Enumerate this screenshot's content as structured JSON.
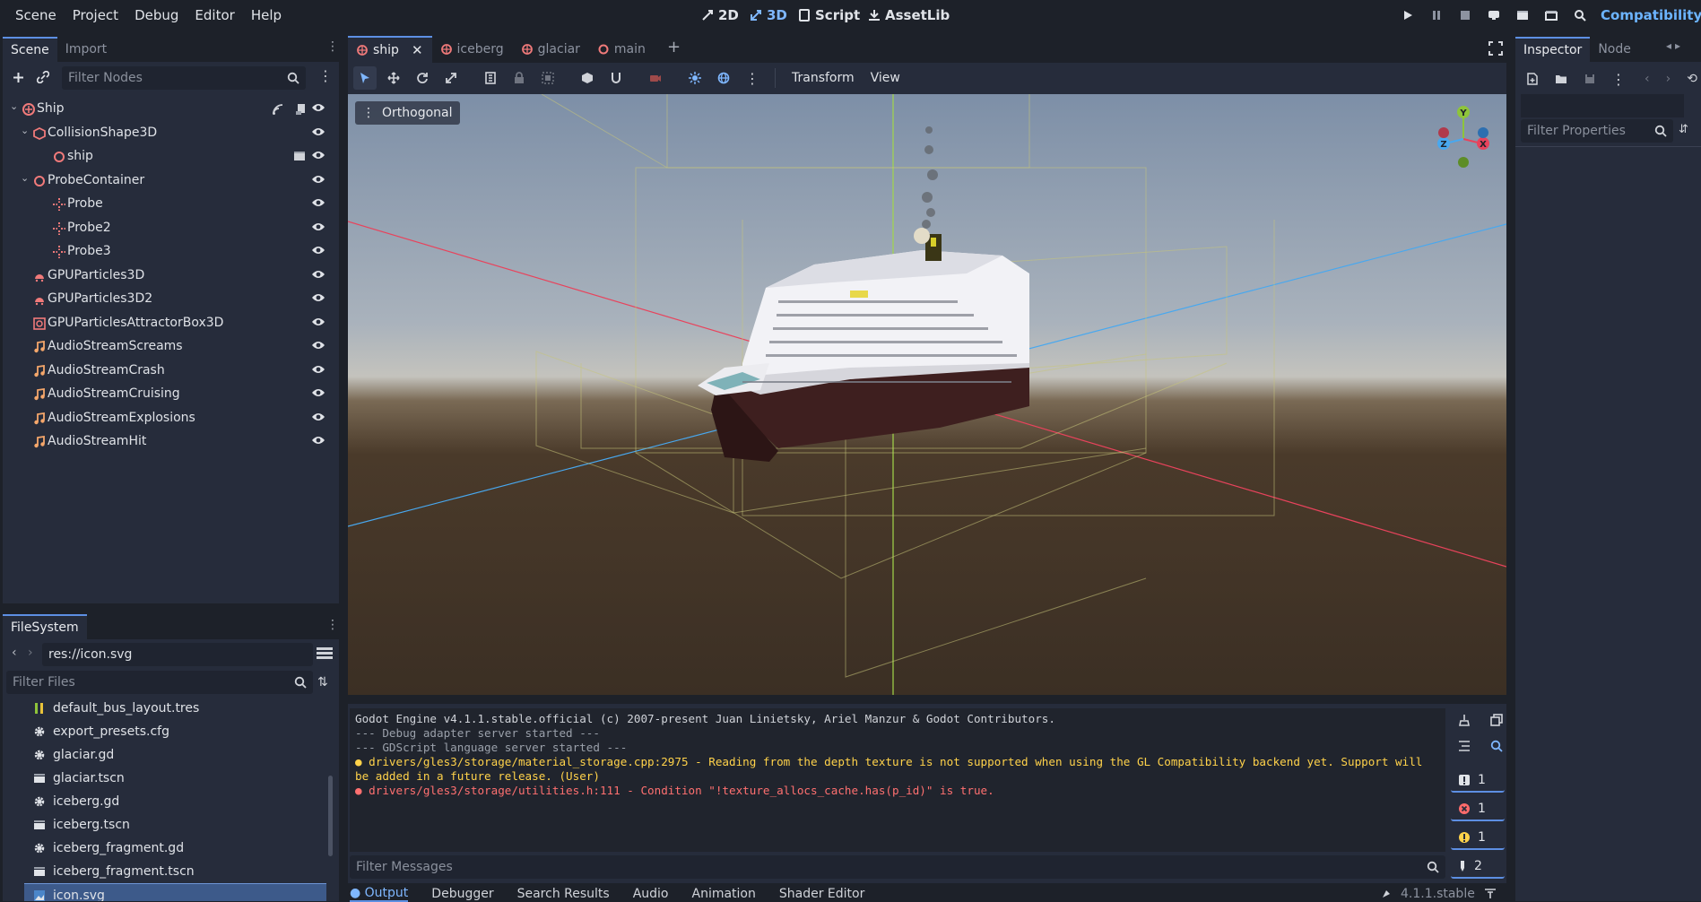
{
  "menu": [
    "Scene",
    "Project",
    "Debug",
    "Editor",
    "Help"
  ],
  "workspaces": [
    {
      "label": "2D",
      "active": false
    },
    {
      "label": "3D",
      "active": true
    },
    {
      "label": "Script",
      "active": false
    },
    {
      "label": "AssetLib",
      "active": false
    }
  ],
  "renderer": "Compatibility",
  "scene_panel": {
    "tabs": [
      "Scene",
      "Import"
    ],
    "filter_placeholder": "Filter Nodes",
    "nodes": [
      {
        "label": "Ship",
        "icon": "scene-root-icon",
        "depth": 0,
        "expanded": true
      },
      {
        "label": "CollisionShape3D",
        "icon": "collision-shape-icon",
        "depth": 1,
        "expanded": true
      },
      {
        "label": "ship",
        "icon": "node3d-icon",
        "depth": 2
      },
      {
        "label": "ProbeContainer",
        "icon": "node3d-icon",
        "depth": 1,
        "expanded": true
      },
      {
        "label": "Probe",
        "icon": "marker-icon",
        "depth": 2
      },
      {
        "label": "Probe2",
        "icon": "marker-icon",
        "depth": 2
      },
      {
        "label": "Probe3",
        "icon": "marker-icon",
        "depth": 2
      },
      {
        "label": "GPUParticles3D",
        "icon": "particles-icon",
        "depth": 1
      },
      {
        "label": "GPUParticles3D2",
        "icon": "particles-icon",
        "depth": 1
      },
      {
        "label": "GPUParticlesAttractorBox3D",
        "icon": "attractor-icon",
        "depth": 1
      },
      {
        "label": "AudioStreamScreams",
        "icon": "audio-icon",
        "depth": 1
      },
      {
        "label": "AudioStreamCrash",
        "icon": "audio-icon",
        "depth": 1
      },
      {
        "label": "AudioStreamCruising",
        "icon": "audio-icon",
        "depth": 1
      },
      {
        "label": "AudioStreamExplosions",
        "icon": "audio-icon",
        "depth": 1
      },
      {
        "label": "AudioStreamHit",
        "icon": "audio-icon",
        "depth": 1
      }
    ]
  },
  "filesystem": {
    "tab": "FileSystem",
    "path": "res://icon.svg",
    "filter_placeholder": "Filter Files",
    "files": [
      {
        "label": "default_bus_layout.tres",
        "icon": "bus-icon"
      },
      {
        "label": "export_presets.cfg",
        "icon": "gear-icon"
      },
      {
        "label": "glaciar.gd",
        "icon": "gear-icon"
      },
      {
        "label": "glaciar.tscn",
        "icon": "clapper-icon"
      },
      {
        "label": "iceberg.gd",
        "icon": "gear-icon"
      },
      {
        "label": "iceberg.tscn",
        "icon": "clapper-icon"
      },
      {
        "label": "iceberg_fragment.gd",
        "icon": "gear-icon"
      },
      {
        "label": "iceberg_fragment.tscn",
        "icon": "clapper-icon"
      },
      {
        "label": "icon.svg",
        "icon": "image-icon",
        "selected": true
      }
    ]
  },
  "editor_tabs": [
    {
      "label": "ship",
      "active": true
    },
    {
      "label": "iceberg",
      "active": false
    },
    {
      "label": "glaciar",
      "active": false
    },
    {
      "label": "main",
      "active": false
    }
  ],
  "toolbar": {
    "transform": "Transform",
    "view": "View"
  },
  "viewport": {
    "mode": "Orthogonal",
    "gizmo": {
      "y": "Y",
      "x": "X",
      "z": "Z"
    }
  },
  "inspector": {
    "tabs": [
      "Inspector",
      "Node"
    ],
    "filter_placeholder": "Filter Properties"
  },
  "output": {
    "lines": [
      {
        "text": "Godot Engine v4.1.1.stable.official (c) 2007-present Juan Linietsky, Ariel Manzur & Godot Contributors.",
        "kind": "normal"
      },
      {
        "text": "--- Debug adapter server started ---",
        "kind": "dim"
      },
      {
        "text": "--- GDScript language server started ---",
        "kind": "dim"
      },
      {
        "text": "drivers/gles3/storage/material_storage.cpp:2975 - Reading from the depth texture is not supported when using the GL Compatibility backend yet. Support will be added in a future release. (User)",
        "kind": "warning"
      },
      {
        "text": "drivers/gles3/storage/utilities.h:111 - Condition \"!texture_allocs_cache.has(p_id)\" is true.",
        "kind": "error"
      }
    ],
    "filter_placeholder": "Filter Messages",
    "counts": {
      "messages": "1",
      "errors": "1",
      "warnings": "1",
      "editor": "2"
    }
  },
  "bottom_tabs": [
    "Output",
    "Debugger",
    "Search Results",
    "Audio",
    "Animation",
    "Shader Editor"
  ],
  "version": "4.1.1.stable",
  "colors": {
    "accent": "#5d8fe3",
    "error": "#ff7070",
    "warning": "#ffd24a",
    "node": "#f07a7a"
  }
}
